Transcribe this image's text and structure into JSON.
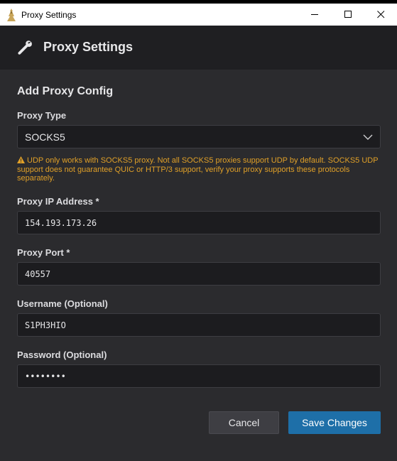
{
  "window": {
    "title": "Proxy Settings",
    "icons": {
      "app": "app-icon",
      "minimize": "minimize-icon",
      "maximize": "maximize-icon",
      "close": "close-icon"
    }
  },
  "header": {
    "title": "Proxy Settings",
    "icon": "wrench-icon"
  },
  "form": {
    "section_title": "Add Proxy Config",
    "proxy_type": {
      "label": "Proxy Type",
      "value": "SOCKS5",
      "icon": "chevron-down-icon"
    },
    "warning": {
      "icon": "warning-icon",
      "text": "UDP only works with SOCKS5 proxy. Not all SOCKS5 proxies support UDP by default. SOCKS5 UDP support does not guarantee QUIC or HTTP/3 support, verify your proxy supports these protocols separately."
    },
    "ip_address": {
      "label": "Proxy IP Address *",
      "value": "154.193.173.26"
    },
    "port": {
      "label": "Proxy Port *",
      "value": "40557"
    },
    "username": {
      "label": "Username (Optional)",
      "value": "S1PH3HIO"
    },
    "password": {
      "label": "Password (Optional)",
      "value": "••••••••"
    }
  },
  "actions": {
    "cancel_label": "Cancel",
    "save_label": "Save Changes"
  },
  "colors": {
    "background": "#2b2b2e",
    "header": "#1f1f22",
    "field": "#1c1c1f",
    "warning": "#e0a028",
    "primary": "#1e6fa8"
  }
}
